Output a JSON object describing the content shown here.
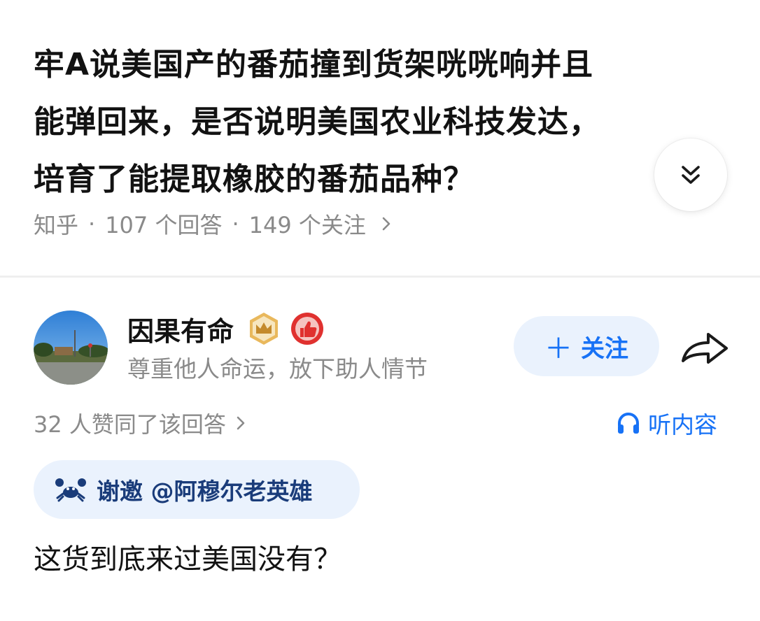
{
  "question": {
    "title": "牢A说美国产的番茄撞到货架咣咣响并且能弹回来，是否说明美国农业科技发达，培育了能提取橡胶的番茄品种？",
    "title_lines": [
      "牢A说美国产的番茄撞到货架咣咣响并且",
      "能弹回来，是否说明美国农业科技发达，",
      "培育了能提取橡胶的番茄品种？"
    ],
    "source": "知乎",
    "answers_count": "107 个回答",
    "followers_count": "149 个关注",
    "expand_icon": "chevron-double-down-icon"
  },
  "answer": {
    "author": {
      "name": "因果有命",
      "bio": "尊重他人命运，放下助人情节",
      "badges": [
        "crown-badge-icon",
        "thumb-up-badge-icon"
      ]
    },
    "follow_label": "关注",
    "share_icon": "share-arrow-icon",
    "likes_text": "32 人赞同了该回答",
    "listen_label": "听内容",
    "invite_text": "谢邀 @阿穆尔老英雄",
    "content": "这货到底来过美国没有？"
  },
  "colors": {
    "accent": "#1772f6",
    "accent_bg": "#eaf2fd",
    "muted_text": "#8a8a8a",
    "badge_gold": "#d9a84e",
    "badge_red": "#e0312f"
  }
}
